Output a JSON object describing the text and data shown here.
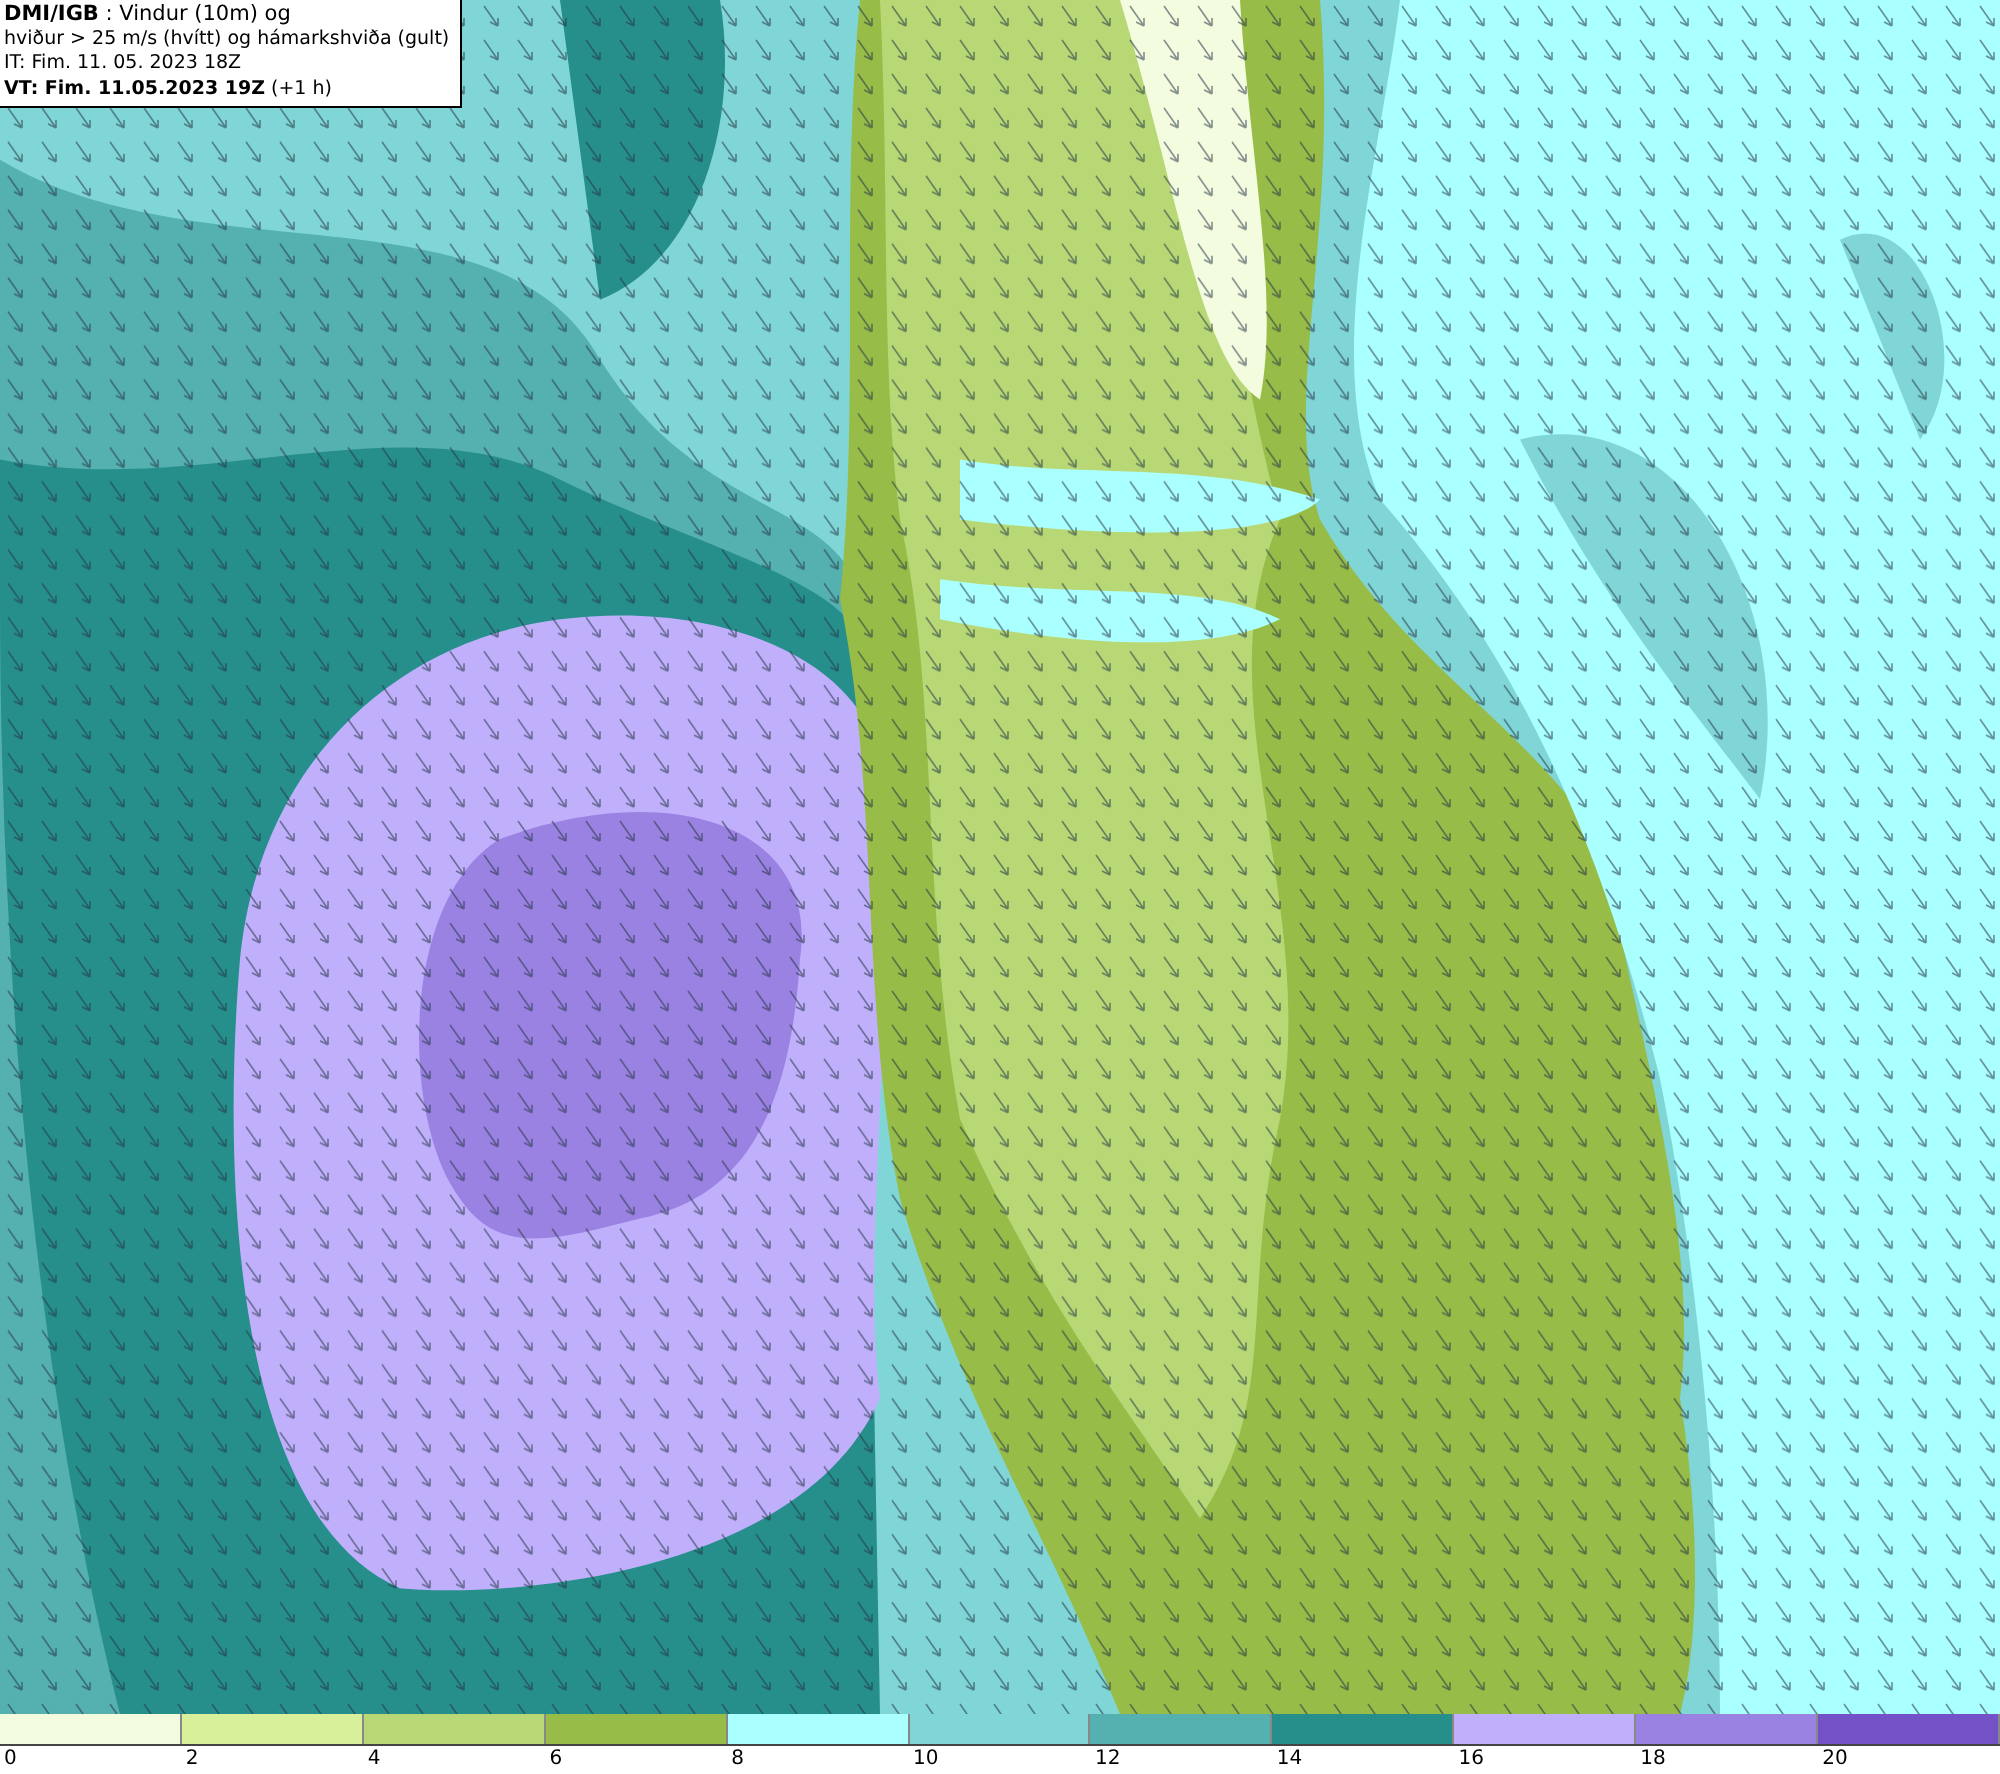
{
  "title_box": {
    "lines": [
      "**DMI/IGB** : Vindur (10m) og",
      "hviður > 25 m/s (hvítt) og hámarkshviða (gult)",
      "IT: Fim. 11. 05. 2023 18Z",
      "**VT: Fim. 11.05.2023 19Z** (+1 h)"
    ]
  },
  "legend": {
    "swatches": [
      {
        "color": "#f4fce0"
      },
      {
        "color": "#d8f09a"
      },
      {
        "color": "#b8d875"
      },
      {
        "color": "#98bc48"
      },
      {
        "color": "#aaffff"
      },
      {
        "color": "#80d6d6"
      },
      {
        "color": "#55b0b0"
      },
      {
        "color": "#268f8c"
      },
      {
        "color": "#c0b0fc"
      },
      {
        "color": "#9a82e2"
      },
      {
        "color": "#7252c6"
      }
    ],
    "ticks": [
      "0",
      "2",
      "4",
      "6",
      "8",
      "10",
      "12",
      "14",
      "16",
      "18",
      "20"
    ]
  }
}
